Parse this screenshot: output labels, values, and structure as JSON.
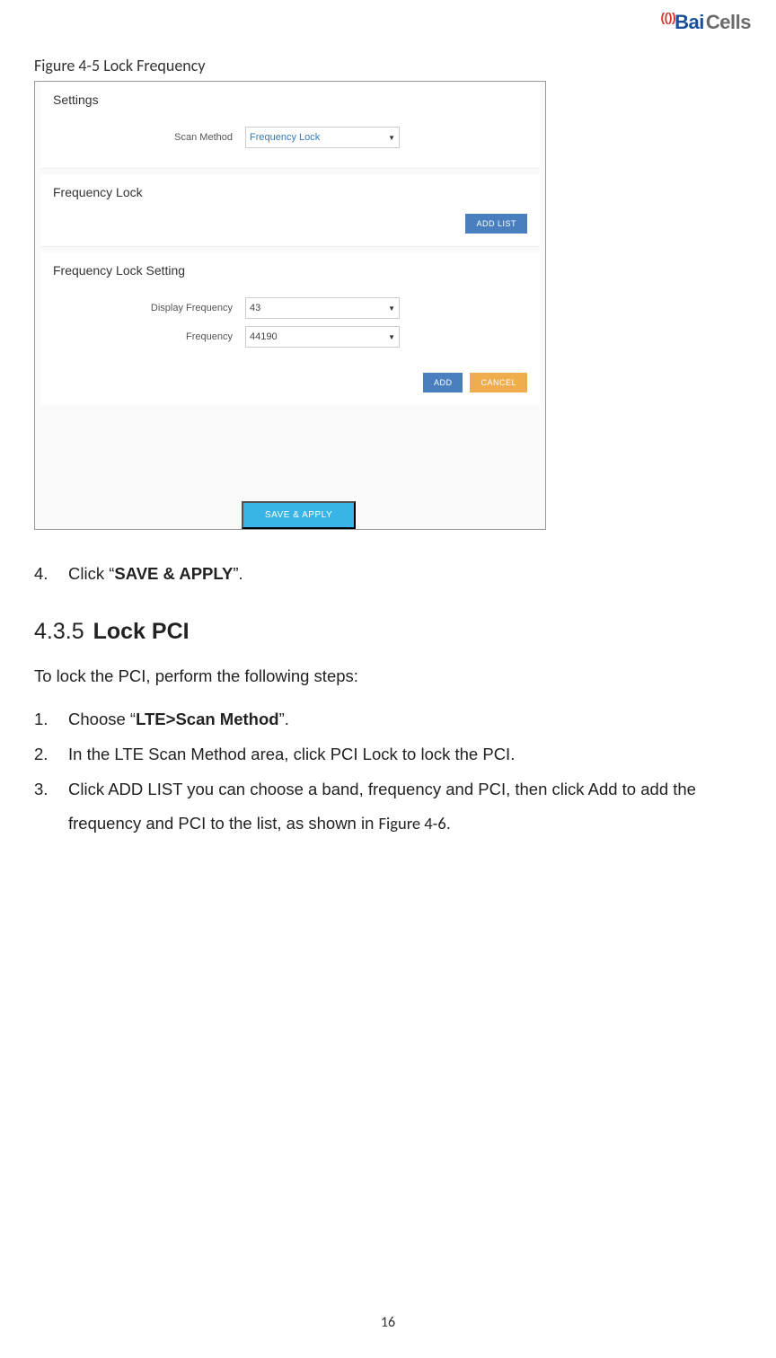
{
  "logo": {
    "bai": "Bai",
    "cells": "Cells"
  },
  "figure_caption": "Figure 4-5 Lock Frequency",
  "screenshot": {
    "settings_title": "Settings",
    "scan_method_label": "Scan Method",
    "scan_method_value": "Frequency Lock",
    "freq_lock_title": "Frequency Lock",
    "add_list_btn": "ADD LIST",
    "fls_title": "Frequency Lock Setting",
    "display_freq_label": "Display Frequency",
    "display_freq_value": "43",
    "frequency_label": "Frequency",
    "frequency_value": "44190",
    "add_btn": "ADD",
    "cancel_btn": "CANCEL",
    "save_apply_btn": "SAVE & APPLY"
  },
  "step4": {
    "num": "4.",
    "prefix": "Click “",
    "bold": "SAVE & APPLY",
    "suffix": "”."
  },
  "section": {
    "num": "4.3.5",
    "title": "Lock PCI"
  },
  "intro": "To lock the PCI, perform the following steps:",
  "steps": {
    "s1": {
      "num": "1.",
      "prefix": "Choose “",
      "bold": "LTE>Scan Method",
      "suffix": "”."
    },
    "s2": {
      "num": "2.",
      "text": "In the LTE Scan Method area, click PCI Lock to lock the PCI."
    },
    "s3": {
      "num": "3.",
      "text_a": "Click ADD LIST you can choose a band, frequency and PCI, then click Add to add the",
      "text_b": "frequency and PCI to the list, as shown in ",
      "figref": "Figure 4-6",
      "text_c": "."
    }
  },
  "page_num": "16"
}
